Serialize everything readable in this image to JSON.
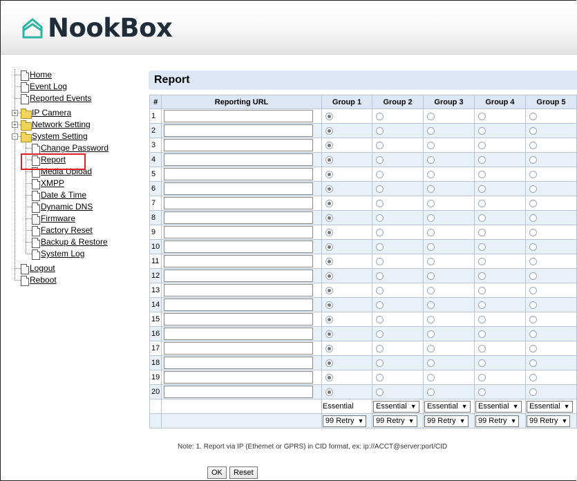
{
  "brand": {
    "name": "NookBox"
  },
  "nav": {
    "items": [
      {
        "label": "Home"
      },
      {
        "label": "Event Log"
      },
      {
        "label": "Reported Events"
      },
      {
        "label": "IP Camera"
      },
      {
        "label": "Network Setting"
      },
      {
        "label": "System Setting"
      },
      {
        "label": "Change Password"
      },
      {
        "label": "Report"
      },
      {
        "label": "Media Upload"
      },
      {
        "label": "XMPP"
      },
      {
        "label": "Date & Time"
      },
      {
        "label": "Dynamic DNS"
      },
      {
        "label": "Firmware"
      },
      {
        "label": "Factory Reset"
      },
      {
        "label": "Backup & Restore"
      },
      {
        "label": "System Log"
      },
      {
        "label": "Logout"
      },
      {
        "label": "Reboot"
      }
    ],
    "selected": "Report"
  },
  "page": {
    "title": "Report"
  },
  "table": {
    "headers": [
      "#",
      "Reporting URL",
      "Group 1",
      "Group 2",
      "Group 3",
      "Group 4",
      "Group 5"
    ],
    "rows": [
      "1",
      "2",
      "3",
      "4",
      "5",
      "6",
      "7",
      "8",
      "9",
      "10",
      "11",
      "12",
      "13",
      "14",
      "15",
      "16",
      "17",
      "18",
      "19",
      "20"
    ],
    "selected_group": "Group 1",
    "level_row": {
      "group1": "Essential",
      "others": [
        "Essential",
        "Essential",
        "Essential",
        "Essential"
      ]
    },
    "retry_row": [
      "99 Retry",
      "99 Retry",
      "99 Retry",
      "99 Retry",
      "99 Retry"
    ]
  },
  "note": "Note:  1. Report via IP (Ethernet or GPRS) in CID format, ex: ip://ACCT@server:port/CID",
  "buttons": {
    "ok": "OK",
    "reset": "Reset"
  },
  "colors": {
    "header_bg": "#dde6f4",
    "highlight": "#e02020",
    "logo_icon": "#2bb3a3"
  }
}
